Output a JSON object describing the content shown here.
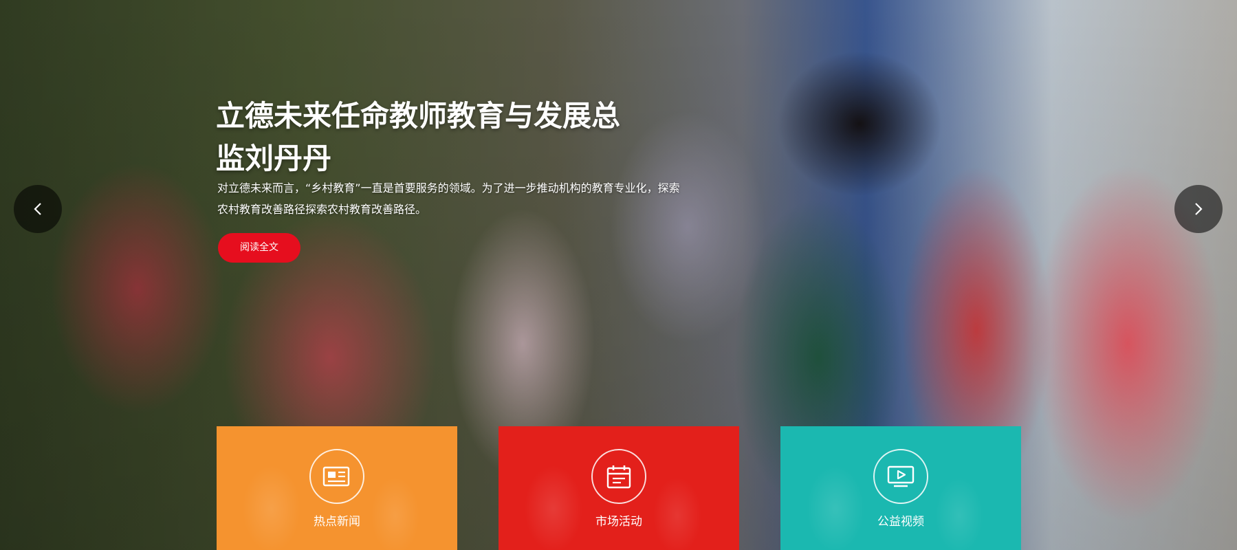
{
  "hero": {
    "headline": "立德未来任命教师教育与发展总监刘丹丹",
    "summary": "对立德未来而言，“乡村教育”一直是首要服务的领域。为了进一步推动机构的教育专业化，探索农村教育改善路径探索农村教育改善路径。",
    "read_more_label": "阅读全文",
    "prev_icon": "chevron-left-icon",
    "next_icon": "chevron-right-icon"
  },
  "tiles": [
    {
      "label": "热点新闻",
      "icon": "newspaper-icon",
      "color": "#f5932f"
    },
    {
      "label": "市场活动",
      "icon": "calendar-icon",
      "color": "#e3201b"
    },
    {
      "label": "公益视频",
      "icon": "video-play-icon",
      "color": "#1bb8b0"
    }
  ],
  "colors": {
    "accent_red": "#e60e1e"
  }
}
